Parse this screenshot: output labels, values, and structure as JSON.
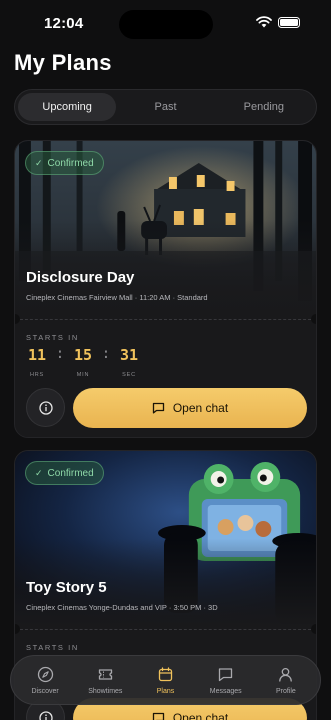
{
  "status_bar": {
    "time": "12:04"
  },
  "page": {
    "title": "My Plans"
  },
  "tabs": [
    {
      "label": "Upcoming",
      "active": true
    },
    {
      "label": "Past",
      "active": false
    },
    {
      "label": "Pending",
      "active": false
    }
  ],
  "plans": [
    {
      "badge": "Confirmed",
      "title": "Disclosure Day",
      "meta": "Cineplex Cinemas Fairview Mall · 11:20 AM · Standard",
      "starts_in_label": "STARTS IN",
      "countdown": {
        "hours": "11",
        "minutes": "15",
        "seconds": "31",
        "hours_label": "HRS",
        "minutes_label": "MIN",
        "seconds_label": "SEC"
      },
      "chat_label": "Open chat"
    },
    {
      "badge": "Confirmed",
      "title": "Toy Story 5",
      "meta": "Cineplex Cinemas Yonge-Dundas and VIP · 3:50 PM · 3D",
      "starts_in_label": "STARTS IN",
      "chat_label": "Open chat"
    }
  ],
  "bottom_nav": [
    {
      "label": "Discover",
      "icon": "compass-icon",
      "active": false
    },
    {
      "label": "Showtimes",
      "icon": "ticket-icon",
      "active": false
    },
    {
      "label": "Plans",
      "icon": "calendar-icon",
      "active": true
    },
    {
      "label": "Messages",
      "icon": "message-icon",
      "active": false
    },
    {
      "label": "Profile",
      "icon": "user-icon",
      "active": false
    }
  ],
  "colors": {
    "accent": "#f0c25c",
    "confirmed": "#8fd9a8",
    "background": "#0f0f10"
  }
}
